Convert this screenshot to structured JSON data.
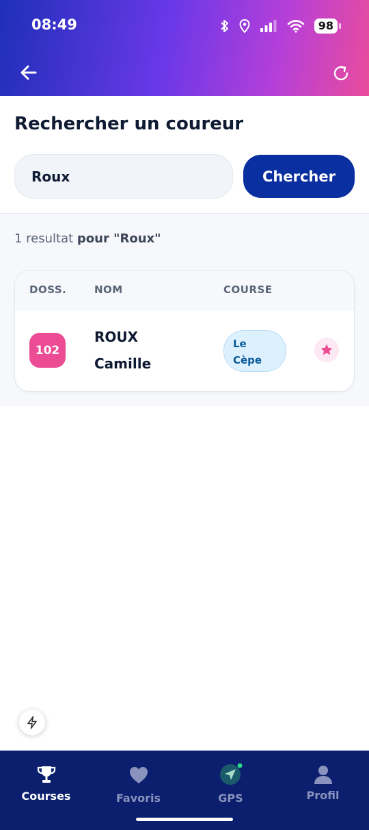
{
  "status_bar": {
    "time": "08:49",
    "battery": "98"
  },
  "search": {
    "title": "Rechercher un coureur",
    "query": "Roux",
    "button_label": "Chercher"
  },
  "results": {
    "count_prefix": "1 resultat",
    "count_suffix": "pour \"Roux\"",
    "columns": [
      "DOSS.",
      "NOM",
      "COURSE"
    ],
    "rows": [
      {
        "bib": "102",
        "last_name": "ROUX",
        "first_name": "Camille",
        "course_line1": "Le",
        "course_line2": "Cèpe"
      }
    ]
  },
  "nav": {
    "items": [
      {
        "label": "Courses",
        "icon": "trophy-icon",
        "active": true
      },
      {
        "label": "Favoris",
        "icon": "heart-icon",
        "active": false
      },
      {
        "label": "GPS",
        "icon": "navigation-arrow-icon",
        "active": false
      },
      {
        "label": "Profil",
        "icon": "user-icon",
        "active": false
      }
    ]
  },
  "colors": {
    "header_gradient_start": "#1e2fb8",
    "header_gradient_end": "#ea4c9c",
    "primary_button": "#0a2fa0",
    "bib_badge": "#ec4c93",
    "course_badge_bg": "#ddf0fd",
    "nav_background": "#0b1f6e"
  }
}
